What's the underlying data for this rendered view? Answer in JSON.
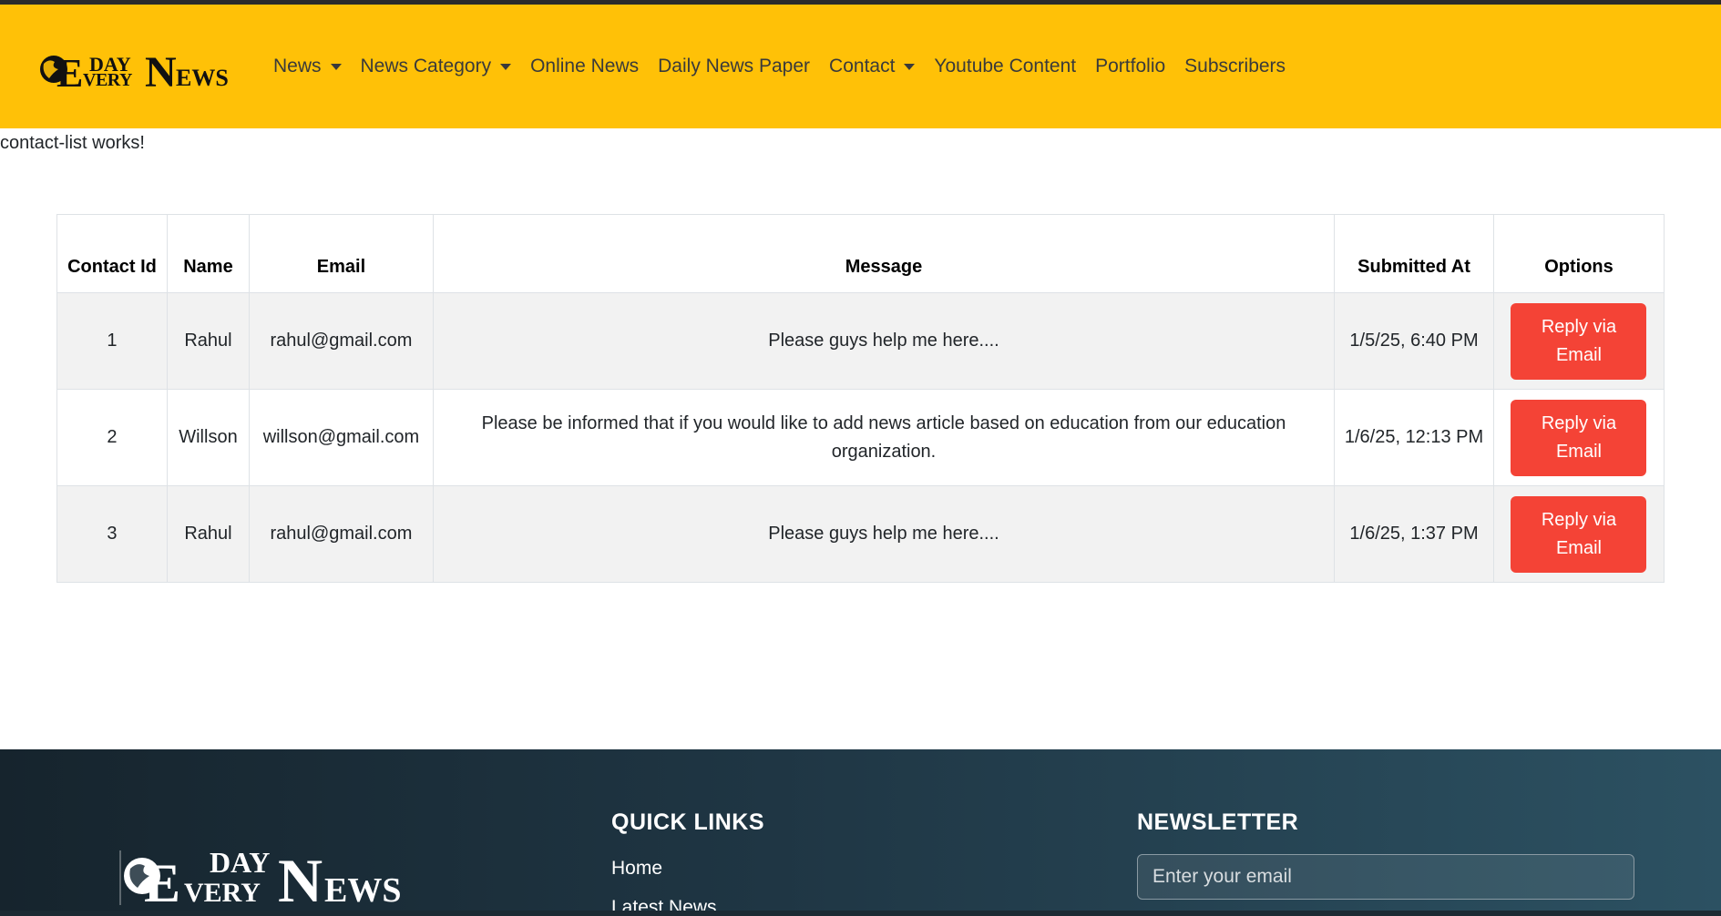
{
  "brand": {
    "logo_top": "DAY",
    "logo_every": "EVERY",
    "logo_news": "NEWS"
  },
  "nav": {
    "items": [
      {
        "label": "News",
        "dropdown": true
      },
      {
        "label": "News Category",
        "dropdown": true
      },
      {
        "label": "Online News",
        "dropdown": false
      },
      {
        "label": "Daily News Paper",
        "dropdown": false
      },
      {
        "label": "Contact",
        "dropdown": true
      },
      {
        "label": "Youtube Content",
        "dropdown": false
      },
      {
        "label": "Portfolio",
        "dropdown": false
      },
      {
        "label": "Subscribers",
        "dropdown": false
      }
    ]
  },
  "page": {
    "works_text": "contact-list works!"
  },
  "table": {
    "headers": {
      "id": "Contact Id",
      "name": "Name",
      "email": "Email",
      "message": "Message",
      "submitted": "Submitted At",
      "options": "Options"
    },
    "rows": [
      {
        "id": "1",
        "name": "Rahul",
        "email": "rahul@gmail.com",
        "message": "Please guys help me here....",
        "submitted": "1/5/25, 6:40 PM",
        "action": "Reply via Email"
      },
      {
        "id": "2",
        "name": "Willson",
        "email": "willson@gmail.com",
        "message": "Please be informed that if you would like to add news article based on education from our education organization.",
        "submitted": "1/6/25, 12:13 PM",
        "action": "Reply via Email"
      },
      {
        "id": "3",
        "name": "Rahul",
        "email": "rahul@gmail.com",
        "message": "Please guys help me here....",
        "submitted": "1/6/25, 1:37 PM",
        "action": "Reply via Email"
      }
    ]
  },
  "footer": {
    "quick_links_heading": "QUICK LINKS",
    "quick_links": [
      "Home",
      "Latest News"
    ],
    "newsletter_heading": "NEWSLETTER",
    "email_placeholder": "Enter your email"
  },
  "colors": {
    "navbar": "#ffc107",
    "reply_button": "#f44336",
    "footer_start": "#16242d",
    "footer_end": "#2c5162"
  }
}
